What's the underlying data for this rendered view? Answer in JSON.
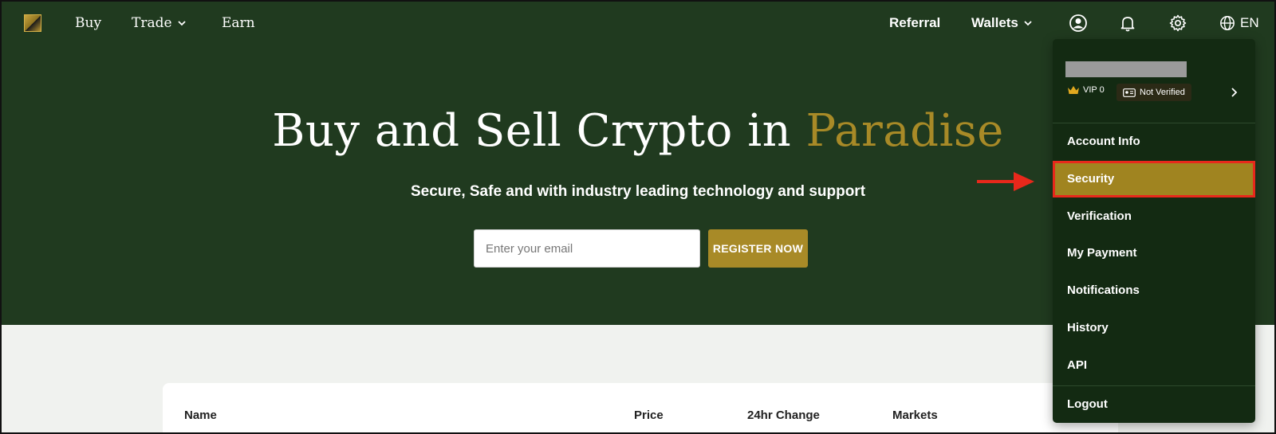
{
  "nav": {
    "buy": "Buy",
    "trade": "Trade",
    "earn": "Earn",
    "referral": "Referral",
    "wallets": "Wallets",
    "language": "EN"
  },
  "icons": {
    "logo": "brand-logo",
    "user": "user-circle-icon",
    "bell": "bell-icon",
    "settings": "gear-icon",
    "globe": "globe-icon"
  },
  "hero": {
    "title_main": "Buy and Sell Crypto in ",
    "title_accent": "Paradise",
    "subtitle": "Secure, Safe and with industry leading technology and support",
    "email_placeholder": "Enter your email",
    "register_label": "REGISTER NOW"
  },
  "markets_table": {
    "columns": [
      "Name",
      "Price",
      "24hr Change",
      "Markets"
    ]
  },
  "account_menu": {
    "vip_label": "VIP 0",
    "verification_badge": "Not Verified",
    "items": [
      "Account Info",
      "Security",
      "Verification",
      "My Payment",
      "Notifications",
      "History",
      "API"
    ],
    "active_item": "Security",
    "logout": "Logout"
  },
  "colors": {
    "hero_bg": "#203a1f",
    "accent_gold": "#a88a27",
    "menu_bg": "#132a12",
    "highlight_red": "#e8281b"
  }
}
